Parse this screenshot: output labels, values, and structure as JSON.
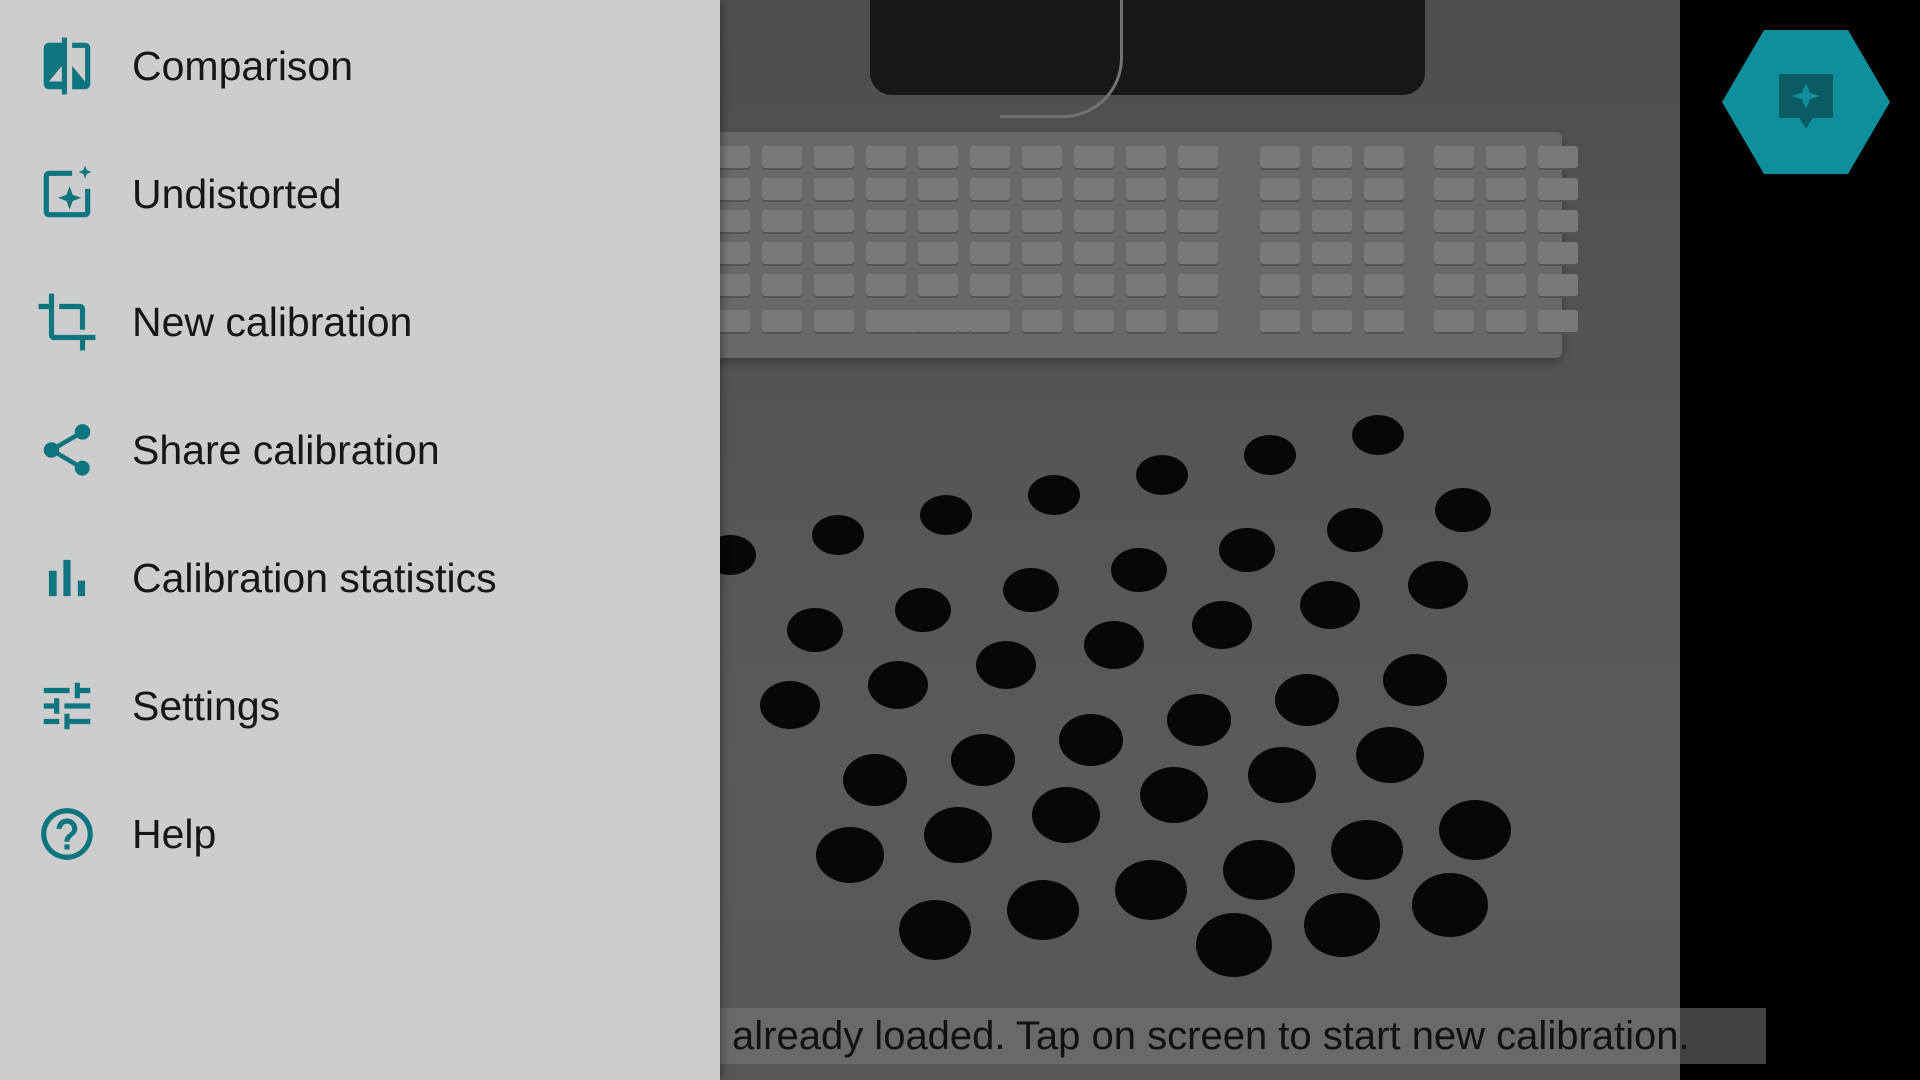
{
  "drawer": {
    "items": [
      {
        "label": "Comparison",
        "icon": "comparison-icon"
      },
      {
        "label": "Undistorted",
        "icon": "undistorted-icon"
      },
      {
        "label": "New calibration",
        "icon": "crop-icon"
      },
      {
        "label": "Share calibration",
        "icon": "share-icon"
      },
      {
        "label": "Calibration statistics",
        "icon": "bar-chart-icon"
      },
      {
        "label": "Settings",
        "icon": "sliders-icon"
      },
      {
        "label": "Help",
        "icon": "help-icon"
      }
    ]
  },
  "fab": {
    "icon": "feedback-icon"
  },
  "toast": {
    "text": "already loaded. Tap on screen to start new calibration."
  },
  "colors": {
    "accent": "#0f8f9c",
    "drawer_bg": "#fafafa",
    "text": "#1b1b1b"
  }
}
